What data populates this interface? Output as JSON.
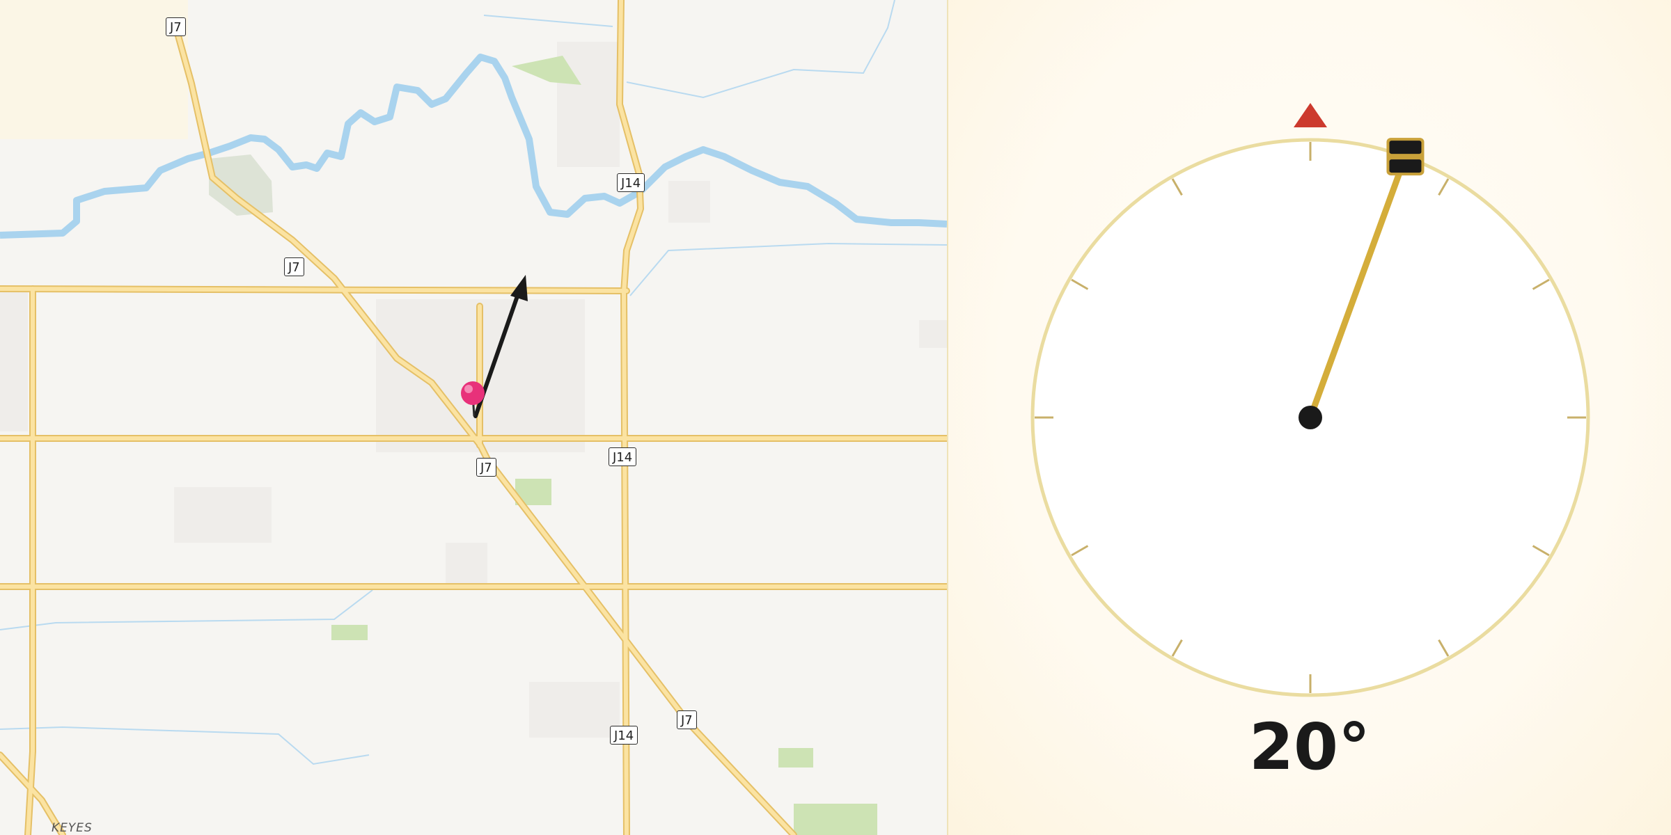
{
  "map": {
    "route_shields": [
      {
        "label": "J7"
      },
      {
        "label": "J7"
      },
      {
        "label": "J7"
      },
      {
        "label": "J7"
      },
      {
        "label": "J14"
      },
      {
        "label": "J14"
      },
      {
        "label": "J14"
      }
    ],
    "place_labels": [
      {
        "label": "KEYES"
      }
    ],
    "marker": {
      "icon": "map-pin-icon",
      "color": "#e8317a"
    },
    "direction_arrow": {
      "icon": "direction-arrow-icon",
      "heading_deg": 20,
      "color": "#1a1a1a"
    },
    "colors": {
      "road": "#f7d37a",
      "water": "#a9d3ee",
      "park": "#cde3b4",
      "background": "#f6f5f2"
    }
  },
  "compass": {
    "heading_deg": 20,
    "heading_label": "20°",
    "north_marker_icon": "north-triangle-icon",
    "handle_icon": "drag-handle-icon",
    "colors": {
      "ring": "#eadca0",
      "needle": "#d4ad3a",
      "north": "#cc3a2e",
      "tick": "#c8b06a",
      "hub": "#1a1a1a"
    }
  }
}
